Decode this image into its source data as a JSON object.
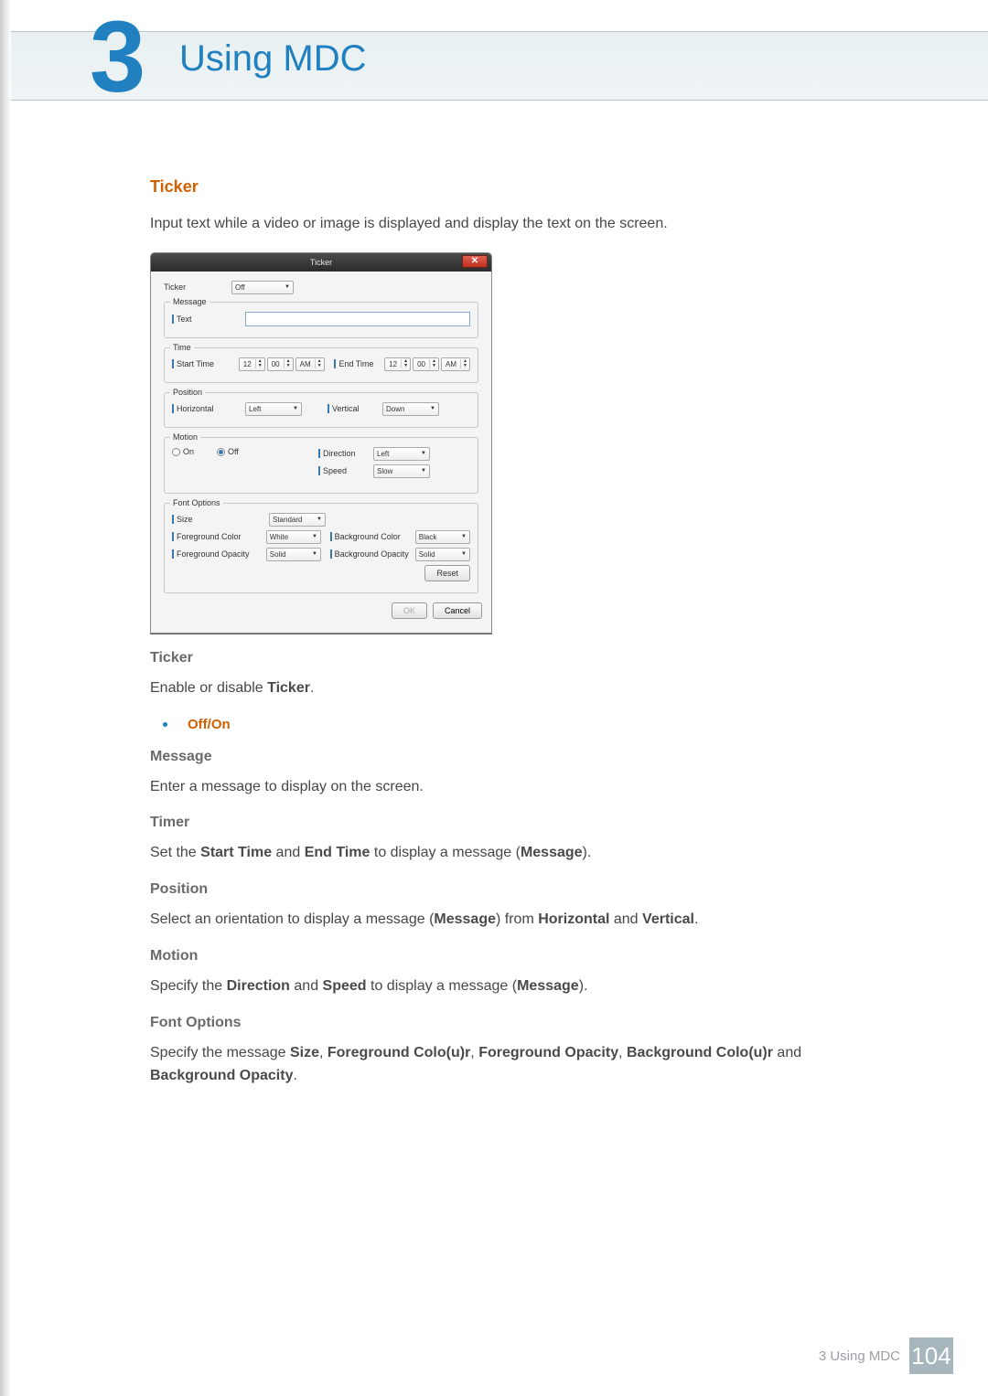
{
  "chapter": {
    "number": "3",
    "title": "Using MDC"
  },
  "section": {
    "heading": "Ticker",
    "intro": "Input text while a video or image is displayed and display the text on the screen."
  },
  "dialog": {
    "title": "Ticker",
    "ticker": {
      "label": "Ticker",
      "value": "Off"
    },
    "message": {
      "legend": "Message",
      "text_label": "Text",
      "text_value": ""
    },
    "time": {
      "legend": "Time",
      "start_label": "Start Time",
      "start_h": "12",
      "start_m": "00",
      "start_ampm": "AM",
      "end_label": "End Time",
      "end_h": "12",
      "end_m": "00",
      "end_ampm": "AM"
    },
    "position": {
      "legend": "Position",
      "horizontal_label": "Horizontal",
      "horizontal_value": "Left",
      "vertical_label": "Vertical",
      "vertical_value": "Down"
    },
    "motion": {
      "legend": "Motion",
      "on_label": "On",
      "off_label": "Off",
      "direction_label": "Direction",
      "direction_value": "Left",
      "speed_label": "Speed",
      "speed_value": "Slow"
    },
    "font": {
      "legend": "Font Options",
      "size_label": "Size",
      "size_value": "Standard",
      "fg_color_label": "Foreground Color",
      "fg_color_value": "White",
      "bg_color_label": "Background Color",
      "bg_color_value": "Black",
      "fg_opacity_label": "Foreground Opacity",
      "fg_opacity_value": "Solid",
      "bg_opacity_label": "Background Opacity",
      "bg_opacity_value": "Solid",
      "reset_label": "Reset"
    },
    "ok_label": "OK",
    "cancel_label": "Cancel"
  },
  "descriptions": {
    "ticker_h": "Ticker",
    "ticker_p_pre": "Enable or disable ",
    "ticker_p_bold": "Ticker",
    "options_off": "Off",
    "options_sep": " / ",
    "options_on": "On",
    "message_h": "Message",
    "message_p": "Enter a message to display on the screen.",
    "timer_h": "Timer",
    "timer_p_1": "Set the ",
    "timer_p_b1": "Start Time",
    "timer_p_2": " and ",
    "timer_p_b2": "End Time",
    "timer_p_3": " to display a message (",
    "timer_p_b3": "Message",
    "timer_p_4": ").",
    "position_h": "Position",
    "position_p_1": "Select an orientation to display a message (",
    "position_p_b1": "Message",
    "position_p_2": ") from ",
    "position_p_b2": "Horizontal",
    "position_p_3": " and ",
    "position_p_b3": "Vertical",
    "position_p_4": ".",
    "motion_h": "Motion",
    "motion_p_1": "Specify the ",
    "motion_p_b1": "Direction",
    "motion_p_2": " and ",
    "motion_p_b2": "Speed",
    "motion_p_3": " to display a message (",
    "motion_p_b3": "Message",
    "motion_p_4": ").",
    "font_h": "Font Options",
    "font_p_1": "Specify the message ",
    "font_p_b1": "Size",
    "font_p_2": ", ",
    "font_p_b2": "Foreground Colo(u)r",
    "font_p_3": ", ",
    "font_p_b3": "Foreground Opacity",
    "font_p_4": ", ",
    "font_p_b4": "Background Colo(u)r",
    "font_p_5": " and ",
    "font_p_b5": "Background Opacity",
    "font_p_6": "."
  },
  "footer": {
    "text": "3 Using MDC",
    "page": "104"
  }
}
